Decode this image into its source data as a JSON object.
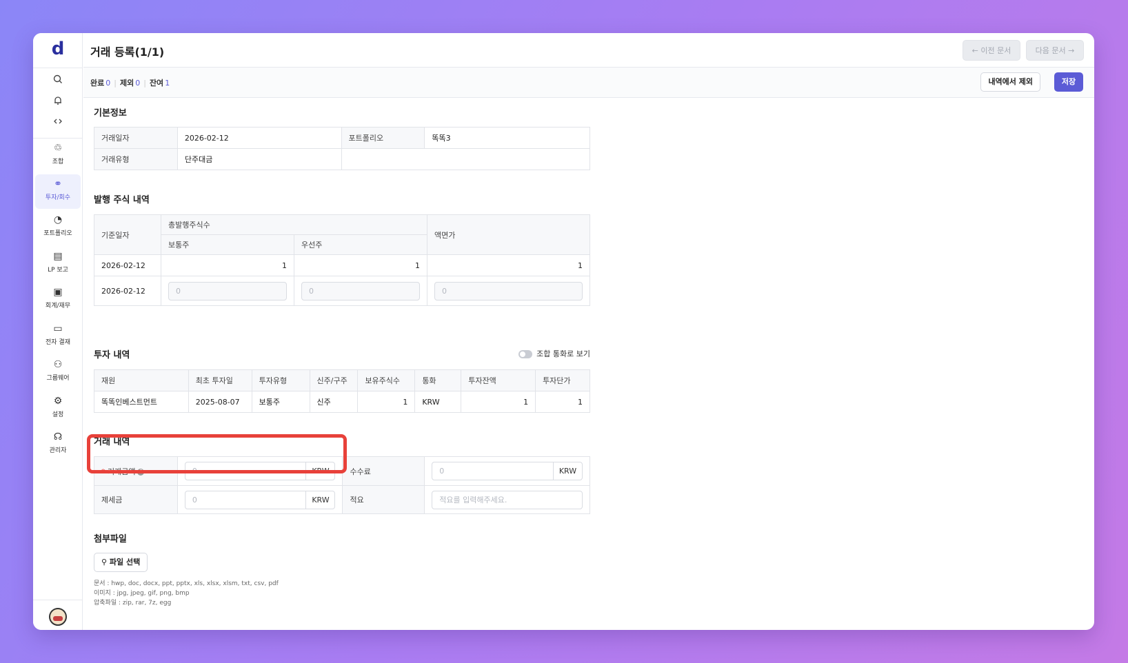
{
  "app": {
    "logo": "d"
  },
  "sidebar": {
    "top_icons": [
      "search-icon",
      "bell-icon",
      "link-icon"
    ],
    "items": [
      {
        "label": "조합",
        "icon": "recycle-icon",
        "active": false
      },
      {
        "label": "투자/회수",
        "icon": "investment-icon",
        "active": true
      },
      {
        "label": "포트폴리오",
        "icon": "pie-chart-icon",
        "active": false
      },
      {
        "label": "LP 보고",
        "icon": "report-icon",
        "active": false
      },
      {
        "label": "회계/재무",
        "icon": "finance-icon",
        "active": false
      },
      {
        "label": "전자 결재",
        "icon": "approval-icon",
        "active": false
      },
      {
        "label": "그룹웨어",
        "icon": "groupware-icon",
        "active": false
      },
      {
        "label": "설정",
        "icon": "gear-icon",
        "active": false
      },
      {
        "label": "관리자",
        "icon": "admin-icon",
        "active": false
      }
    ]
  },
  "header": {
    "title": "거래 등록(1/1)",
    "prev_label": "← 이전 문서",
    "next_label": "다음 문서 →"
  },
  "subbar": {
    "done_label": "완료",
    "done_count": "0",
    "excluded_label": "제외",
    "excluded_count": "0",
    "remaining_label": "잔여",
    "remaining_count": "1",
    "exclude_button": "내역에서 제외",
    "save_button": "저장"
  },
  "basic_info": {
    "title": "기본정보",
    "trade_date_label": "거래일자",
    "trade_date": "2026-02-12",
    "portfolio_label": "포트폴리오",
    "portfolio": "똑똑3",
    "trade_type_label": "거래유형",
    "trade_type": "단주대금"
  },
  "shares": {
    "title": "발행 주식 내역",
    "base_date_label": "기준일자",
    "total_shares_label": "총발행주식수",
    "common_label": "보통주",
    "preferred_label": "우선주",
    "par_label": "액면가",
    "rows": [
      {
        "date": "2026-02-12",
        "common": "1",
        "preferred": "1",
        "par": "1"
      }
    ],
    "input_row": {
      "date": "2026-02-12",
      "common": "0",
      "preferred": "0",
      "par": "0"
    }
  },
  "investment": {
    "title": "투자 내역",
    "toggle_label": "조합 통화로 보기",
    "headers": [
      "재원",
      "최초 투자일",
      "투자유형",
      "신주/구주",
      "보유주식수",
      "통화",
      "투자잔액",
      "투자단가"
    ],
    "rows": [
      [
        "똑똑인베스트먼트",
        "2025-08-07",
        "보통주",
        "신주",
        "1",
        "KRW",
        "1",
        "1"
      ]
    ]
  },
  "trade": {
    "title": "거래 내역",
    "amount_req": "*",
    "amount_label": "거래금액",
    "amount_value": "0",
    "fee_label": "수수료",
    "fee_value": "0",
    "tax_label": "제세금",
    "tax_value": "0",
    "memo_label": "적요",
    "memo_placeholder": "적요를 입력해주세요.",
    "currency": "KRW"
  },
  "attachments": {
    "title": "첨부파일",
    "button": "파일 선택",
    "note_docs": "문서 : hwp, doc, docx, ppt, pptx, xls, xlsx, xlsm, txt, csv, pdf",
    "note_images": "이미지 : jpg, jpeg, gif, png, bmp",
    "note_archives": "압축파일 : zip, rar, 7z, egg"
  }
}
